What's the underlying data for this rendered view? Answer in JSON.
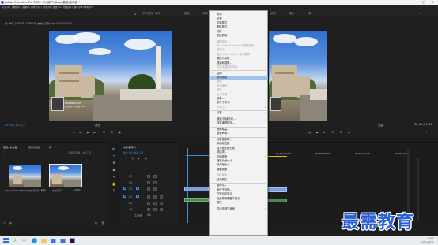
{
  "window": {
    "title": "Adobe Premiere Pro 2020 - C:\\用户\\Ubuy\\桌面\\未命名 *",
    "controls": [
      "—",
      "□",
      "✕"
    ]
  },
  "menubar": [
    "文件(F)",
    "编辑(E)",
    "剪辑(C)",
    "序列(S)",
    "标记(M)",
    "图形(G)",
    "视图(V)",
    "窗口(W)",
    "帮助(H)"
  ],
  "workspaces": {
    "tabs": [
      "学习",
      "组件",
      "编辑",
      "颜色",
      "效果",
      "音频",
      "图形",
      "库"
    ],
    "active_index": 2
  },
  "source_monitor": {
    "tab": "源: IMG_20200512_P0425_未命名序列.mp4:00;00;00;00",
    "timecode": "00;00;02;27",
    "zoom": "适合",
    "photo_text": [
      "WANDERLUST",
      "自然风光 4K 视频 2020"
    ]
  },
  "program_monitor": {
    "tab": "节目: 未命名序列",
    "timecode": "00;00;02;22",
    "zoom": "完整",
    "duration": "00;00;21;00"
  },
  "project_panel": {
    "tabs": [
      "项目: 未命名",
      "媒体浏览器",
      "库"
    ],
    "items_count": "1 项已选择，共 2 项",
    "items": [
      {
        "name": "IMG_20200512_P0425_未命名序列.mp4",
        "duration": "1:00"
      },
      {
        "name": "未命名序列",
        "duration": "21:00"
      }
    ]
  },
  "timeline": {
    "tab": "未命名序列",
    "timecode": "00;00;02;22",
    "ruler": [
      "00;00",
      "00;00;04;00",
      "00;00;08;00",
      "00;00;12;00",
      "00;00;16;00"
    ],
    "tracks": [
      {
        "name": "V3"
      },
      {
        "name": "V2"
      },
      {
        "name": "V1"
      },
      {
        "name": "A1"
      },
      {
        "name": "A2"
      },
      {
        "name": "A3"
      }
    ],
    "master": "主声道",
    "master_value": "0.0",
    "tools": [
      "▶",
      "⇥",
      "✥",
      "◆",
      "✎",
      "✋",
      "T"
    ]
  },
  "context_menu": {
    "items": [
      {
        "label": "剪切",
        "disabled": false
      },
      {
        "label": "复制",
        "disabled": false
      },
      {
        "label": "粘贴属性",
        "disabled": false
      },
      {
        "label": "删除属性",
        "disabled": false
      },
      {
        "label": "清除",
        "disabled": false
      },
      {
        "label": "波纹删除",
        "disabled": false
      },
      {
        "sep": true
      },
      {
        "label": "编辑原始",
        "disabled": true
      },
      {
        "label": "在 Adobe Audition 中编辑剪辑",
        "disabled": true
      },
      {
        "label": "替换为",
        "disabled": true
      },
      {
        "label": "使用 After Effects 合成替换",
        "disabled": true
      },
      {
        "label": "替换为剪辑",
        "disabled": false,
        "submenu": true
      },
      {
        "label": "渲染和替换...",
        "disabled": false
      },
      {
        "label": "恢复未渲染的内容",
        "disabled": true
      },
      {
        "sep": true
      },
      {
        "label": "启用",
        "checked": true,
        "disabled": false
      },
      {
        "label": "取消链接",
        "highlighted": true,
        "disabled": false
      },
      {
        "label": "编组",
        "disabled": true
      },
      {
        "label": "取消编组",
        "disabled": true
      },
      {
        "label": "同步",
        "disabled": true
      },
      {
        "label": "合并剪辑...",
        "disabled": true
      },
      {
        "label": "嵌套...",
        "disabled": false
      },
      {
        "label": "制作子序列",
        "disabled": false
      },
      {
        "label": "多机位",
        "disabled": true,
        "submenu": true
      },
      {
        "sep": true
      },
      {
        "label": "标签",
        "disabled": false,
        "submenu": true
      },
      {
        "sep": true
      },
      {
        "label": "速度/持续时间...",
        "disabled": false
      },
      {
        "label": "场景编辑检测...",
        "disabled": false
      },
      {
        "sep": true
      },
      {
        "label": "音频增益...",
        "disabled": false
      },
      {
        "label": "音频声道...",
        "disabled": false
      },
      {
        "sep": true
      },
      {
        "label": "帧定格选项...",
        "disabled": false
      },
      {
        "label": "添加帧定格",
        "disabled": false
      },
      {
        "label": "插入帧定格分段",
        "disabled": false
      },
      {
        "label": "场选项...",
        "disabled": false
      },
      {
        "label": "时间插值",
        "disabled": false,
        "submenu": true
      },
      {
        "label": "缩放为帧大小",
        "disabled": false
      },
      {
        "label": "设为帧大小",
        "disabled": false
      },
      {
        "label": "调整图层",
        "disabled": false
      },
      {
        "sep": true
      },
      {
        "label": "链接媒体...",
        "disabled": true
      },
      {
        "label": "设为脱机...",
        "disabled": false
      },
      {
        "sep": true
      },
      {
        "label": "重命名...",
        "disabled": false
      },
      {
        "label": "制作子剪辑...",
        "disabled": false
      },
      {
        "label": "在项目中显示",
        "disabled": false
      },
      {
        "label": "在资源管理器中显示...",
        "disabled": false
      },
      {
        "label": "属性",
        "disabled": false
      },
      {
        "sep": true
      },
      {
        "label": "显示剪辑关键帧",
        "disabled": false,
        "submenu": true
      }
    ]
  },
  "taskbar": {
    "time": "9:44",
    "date": "2021/6/24"
  },
  "watermark": "最需教育",
  "colors": {
    "accent": "#3e8bd8",
    "menu_highlight": "#9ec4ec",
    "watermark": "#2a5fd8"
  }
}
